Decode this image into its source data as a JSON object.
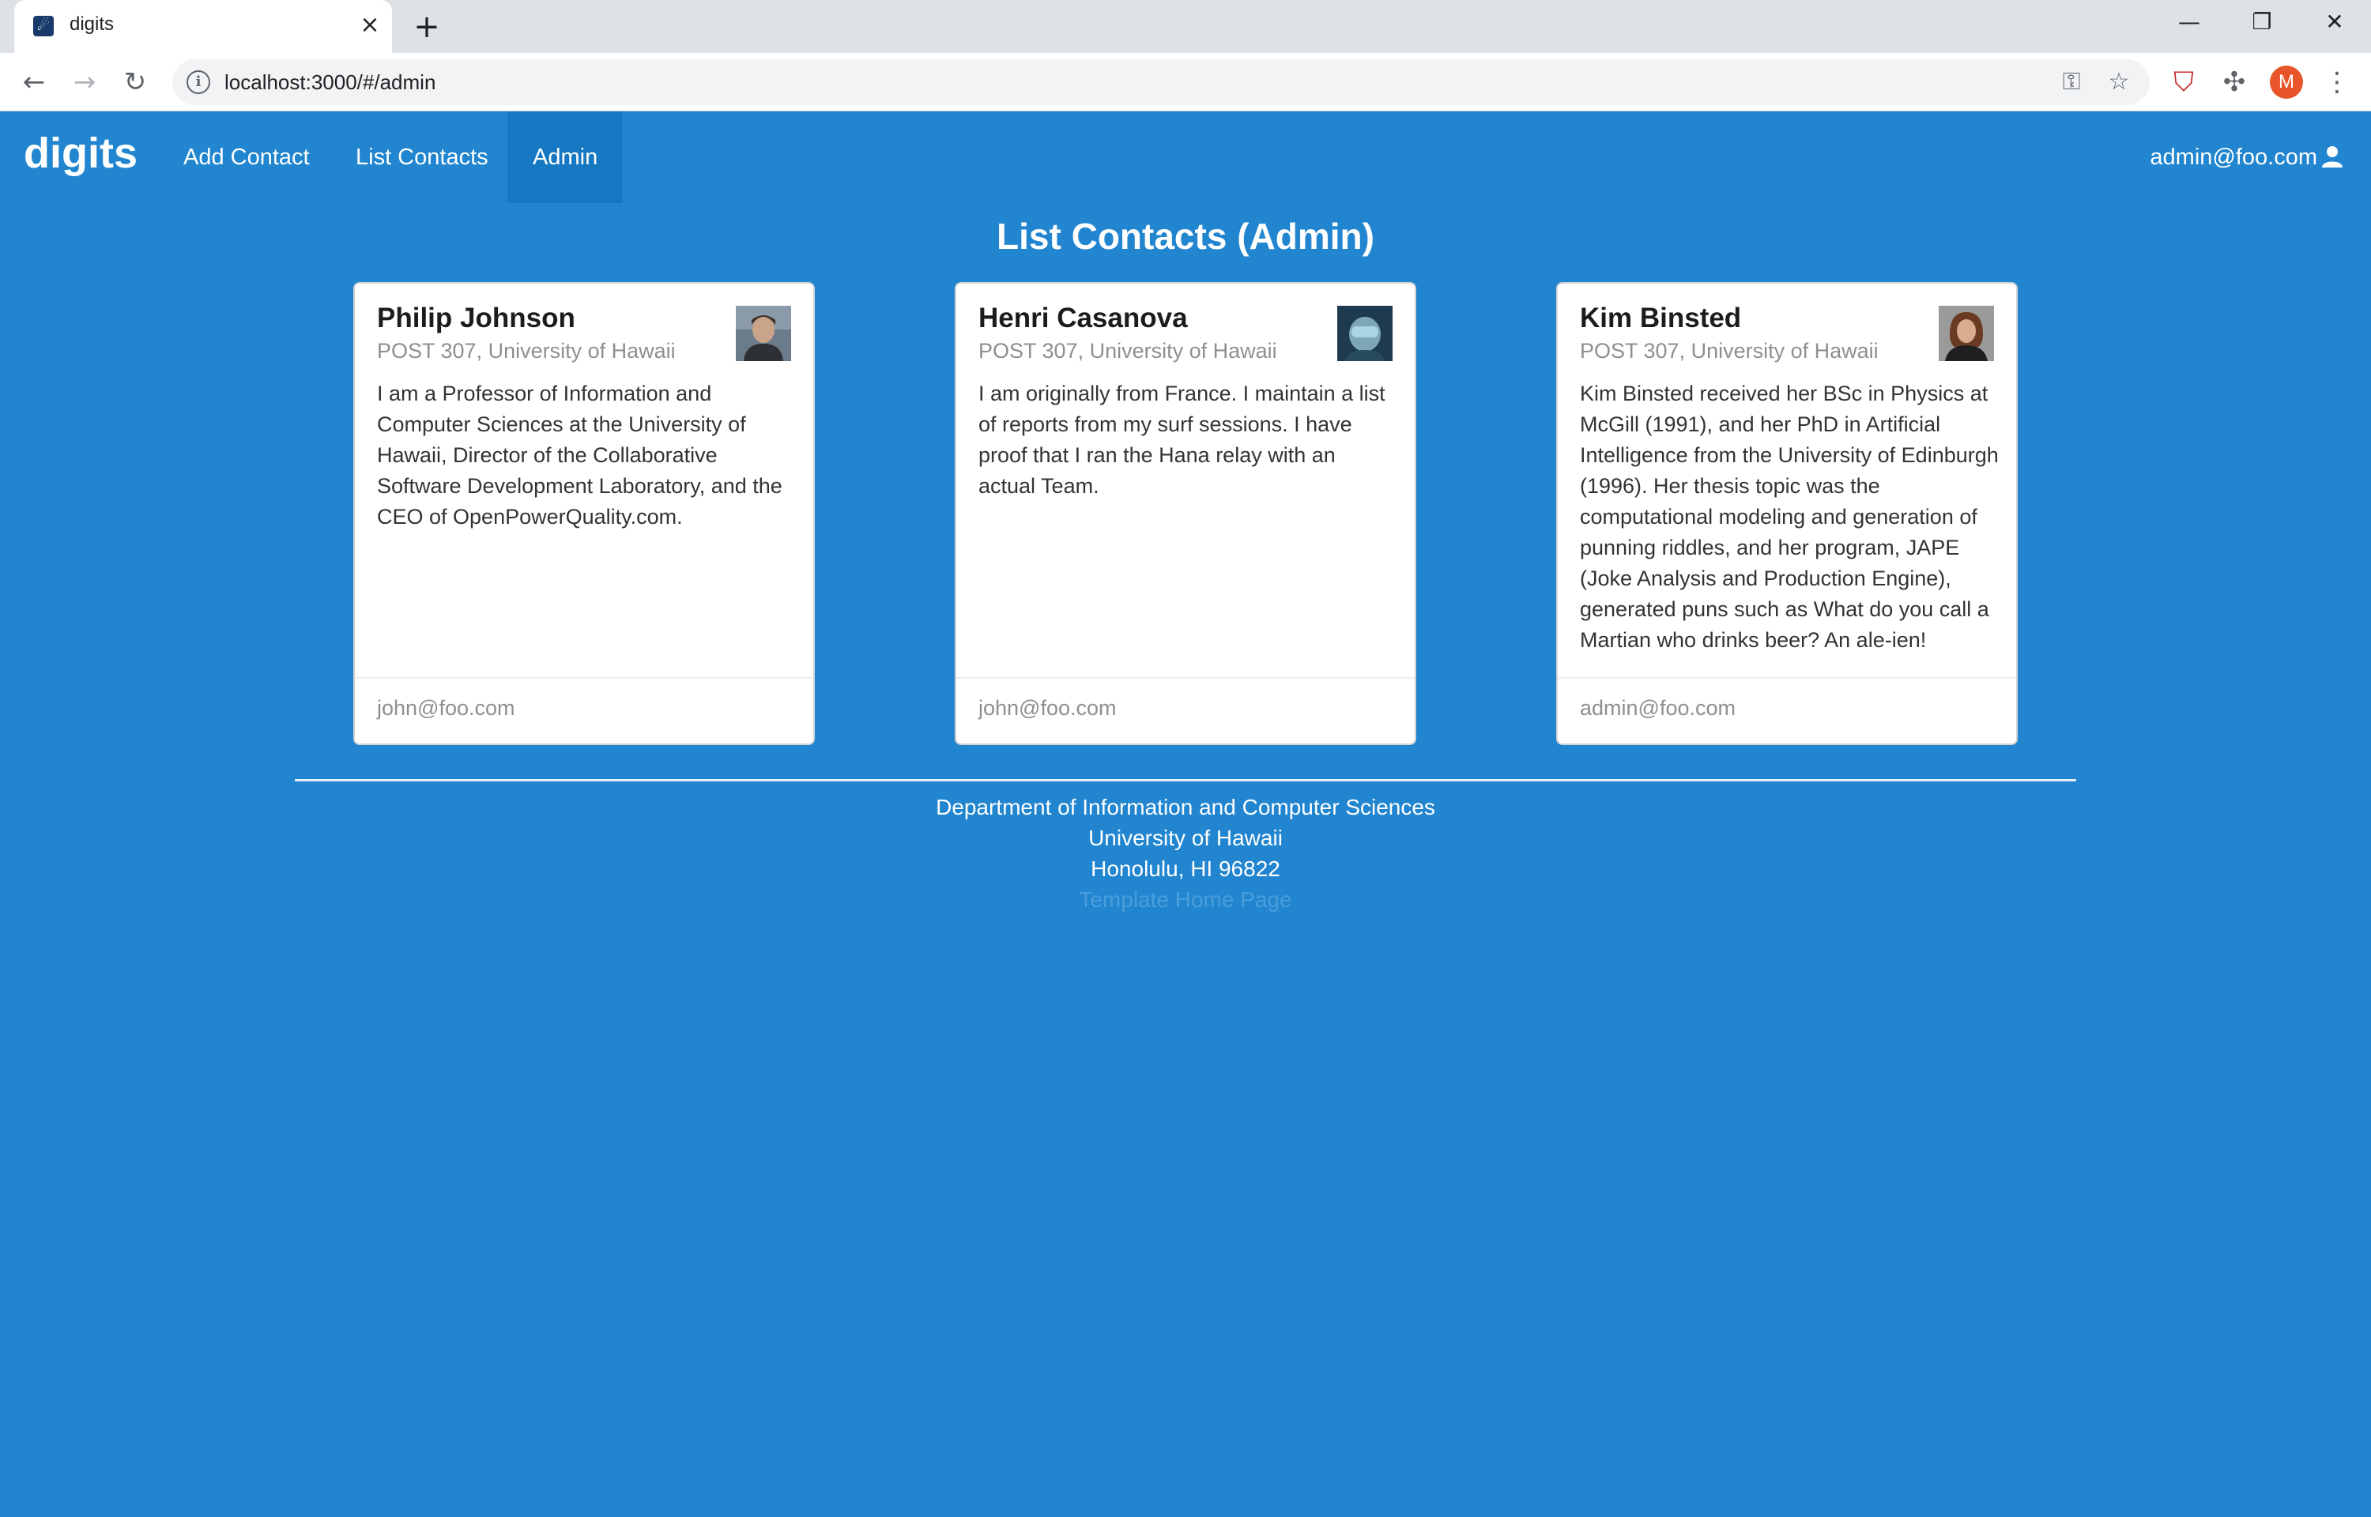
{
  "browser": {
    "tab_title": "digits",
    "favicon": "meteor-icon",
    "url": "localhost:3000/#/admin",
    "profile_initial": "M"
  },
  "app": {
    "brand": "digits",
    "nav": [
      {
        "label": "Add Contact",
        "active": false
      },
      {
        "label": "List Contacts",
        "active": false
      },
      {
        "label": "Admin",
        "active": true
      }
    ],
    "user_email": "admin@foo.com",
    "colors": {
      "primary": "#2185d0",
      "active_nav": "#1678c2"
    }
  },
  "page": {
    "title": "List Contacts (Admin)"
  },
  "contacts": [
    {
      "name": "Philip Johnson",
      "address": "POST 307, University of Hawaii",
      "description": "I am a Professor of Information and Computer Sciences at the University of Hawaii, Director of the Collaborative Software Development Laboratory, and the CEO of OpenPowerQuality.com.",
      "owner": "john@foo.com"
    },
    {
      "name": "Henri Casanova",
      "address": "POST 307, University of Hawaii",
      "description": "I am originally from France. I maintain a list of reports from my surf sessions. I have proof that I ran the Hana relay with an actual Team.",
      "owner": "john@foo.com"
    },
    {
      "name": "Kim Binsted",
      "address": "POST 307, University of Hawaii",
      "description": "Kim Binsted received her BSc in Physics at McGill (1991), and her PhD in Artificial Intelligence from the University of Edinburgh (1996). Her thesis topic was the computational modeling and generation of punning riddles, and her program, JAPE (Joke Analysis and Production Engine), generated puns such as What do you call a Martian who drinks beer? An ale-ien!",
      "owner": "admin@foo.com"
    }
  ],
  "footer": {
    "line1": "Department of Information and Computer Sciences",
    "line2": "University of Hawaii",
    "line3": "Honolulu, HI 96822",
    "link": "Template Home Page"
  }
}
